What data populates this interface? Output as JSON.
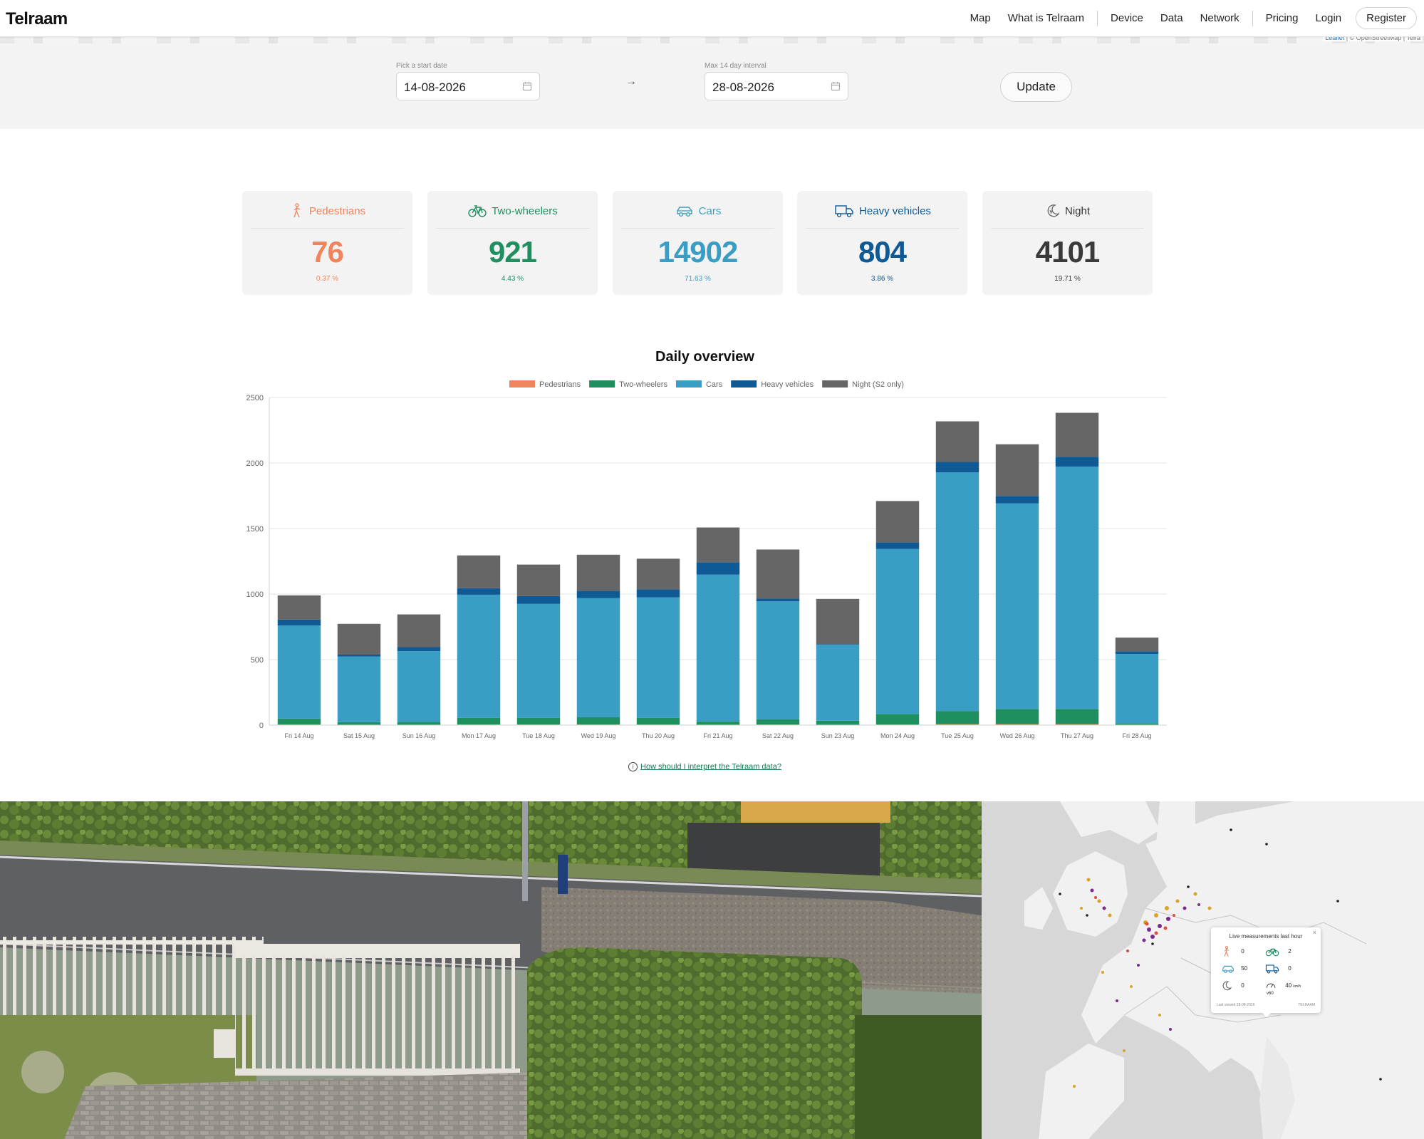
{
  "header": {
    "logo": "Telraam",
    "nav": [
      "Map",
      "What is Telraam",
      "Device",
      "Data",
      "Network",
      "Pricing",
      "Login",
      "Register"
    ]
  },
  "map_attribution": {
    "leaflet": "Leaflet",
    "rest": " | © OpenStreetMap | Telra"
  },
  "datepicker": {
    "start_label": "Pick a start date",
    "start_value": "14-08-2026",
    "arrow": "→",
    "end_label": "Max 14 day interval",
    "end_value": "28-08-2026",
    "update_label": "Update"
  },
  "stats": [
    {
      "label": "Pedestrians",
      "value": "76",
      "percent": "0.37 %",
      "color": "#f0845c",
      "icon": "pedestrian-icon"
    },
    {
      "label": "Two-wheelers",
      "value": "921",
      "percent": "4.43 %",
      "color": "#1f8f5f",
      "icon": "bicycle-icon"
    },
    {
      "label": "Cars",
      "value": "14902",
      "percent": "71.63 %",
      "color": "#3a9dc4",
      "icon": "car-icon"
    },
    {
      "label": "Heavy vehicles",
      "value": "804",
      "percent": "3.86 %",
      "color": "#0f5a94",
      "icon": "truck-icon"
    },
    {
      "label": "Night",
      "value": "4101",
      "percent": "19.71 %",
      "color": "#3a3a3a",
      "icon": "moon-icon"
    }
  ],
  "chart_data": {
    "type": "bar",
    "stacked": true,
    "title": "Daily overview",
    "legend_position": "top",
    "grid": true,
    "ylim": [
      0,
      2500
    ],
    "yticks": [
      0,
      500,
      1000,
      1500,
      2000,
      2500
    ],
    "categories": [
      "Fri 14 Aug",
      "Sat 15 Aug",
      "Sun 16 Aug",
      "Mon 17 Aug",
      "Tue 18 Aug",
      "Wed 19 Aug",
      "Thu 20 Aug",
      "Fri 21 Aug",
      "Sat 22 Aug",
      "Sun 23 Aug",
      "Mon 24 Aug",
      "Tue 25 Aug",
      "Wed 26 Aug",
      "Thu 27 Aug",
      "Fri 28 Aug"
    ],
    "series": [
      {
        "name": "Pedestrians",
        "color": "#f0845c",
        "values": [
          5,
          3,
          3,
          5,
          5,
          5,
          5,
          3,
          5,
          3,
          5,
          8,
          8,
          8,
          3
        ]
      },
      {
        "name": "Two-wheelers",
        "color": "#1f8f5f",
        "values": [
          45,
          20,
          22,
          50,
          50,
          55,
          50,
          25,
          40,
          30,
          80,
          100,
          115,
          115,
          10
        ]
      },
      {
        "name": "Cars",
        "color": "#3a9dc4",
        "values": [
          710,
          500,
          540,
          940,
          870,
          910,
          920,
          1120,
          900,
          580,
          1260,
          1820,
          1570,
          1850,
          530
        ]
      },
      {
        "name": "Heavy vehicles",
        "color": "#0f5a94",
        "values": [
          45,
          15,
          30,
          50,
          60,
          55,
          60,
          95,
          20,
          5,
          50,
          80,
          55,
          75,
          20
        ]
      },
      {
        "name": "Night (S2 only)",
        "color": "#666666",
        "values": [
          185,
          235,
          250,
          250,
          240,
          275,
          235,
          265,
          375,
          345,
          315,
          310,
          395,
          335,
          105
        ]
      }
    ]
  },
  "help_link": "How should I interpret the Telraam data?",
  "popup": {
    "title": "Live measurements last hour",
    "pedestrians": "0",
    "bikes": "2",
    "cars": "50",
    "heavy": "0",
    "night": "0",
    "speed": "40",
    "speed_unit": "km/h",
    "speed_sub": "v60",
    "footer_left": "Last viewed 28-08-2026",
    "footer_right": "TELRAAM"
  }
}
